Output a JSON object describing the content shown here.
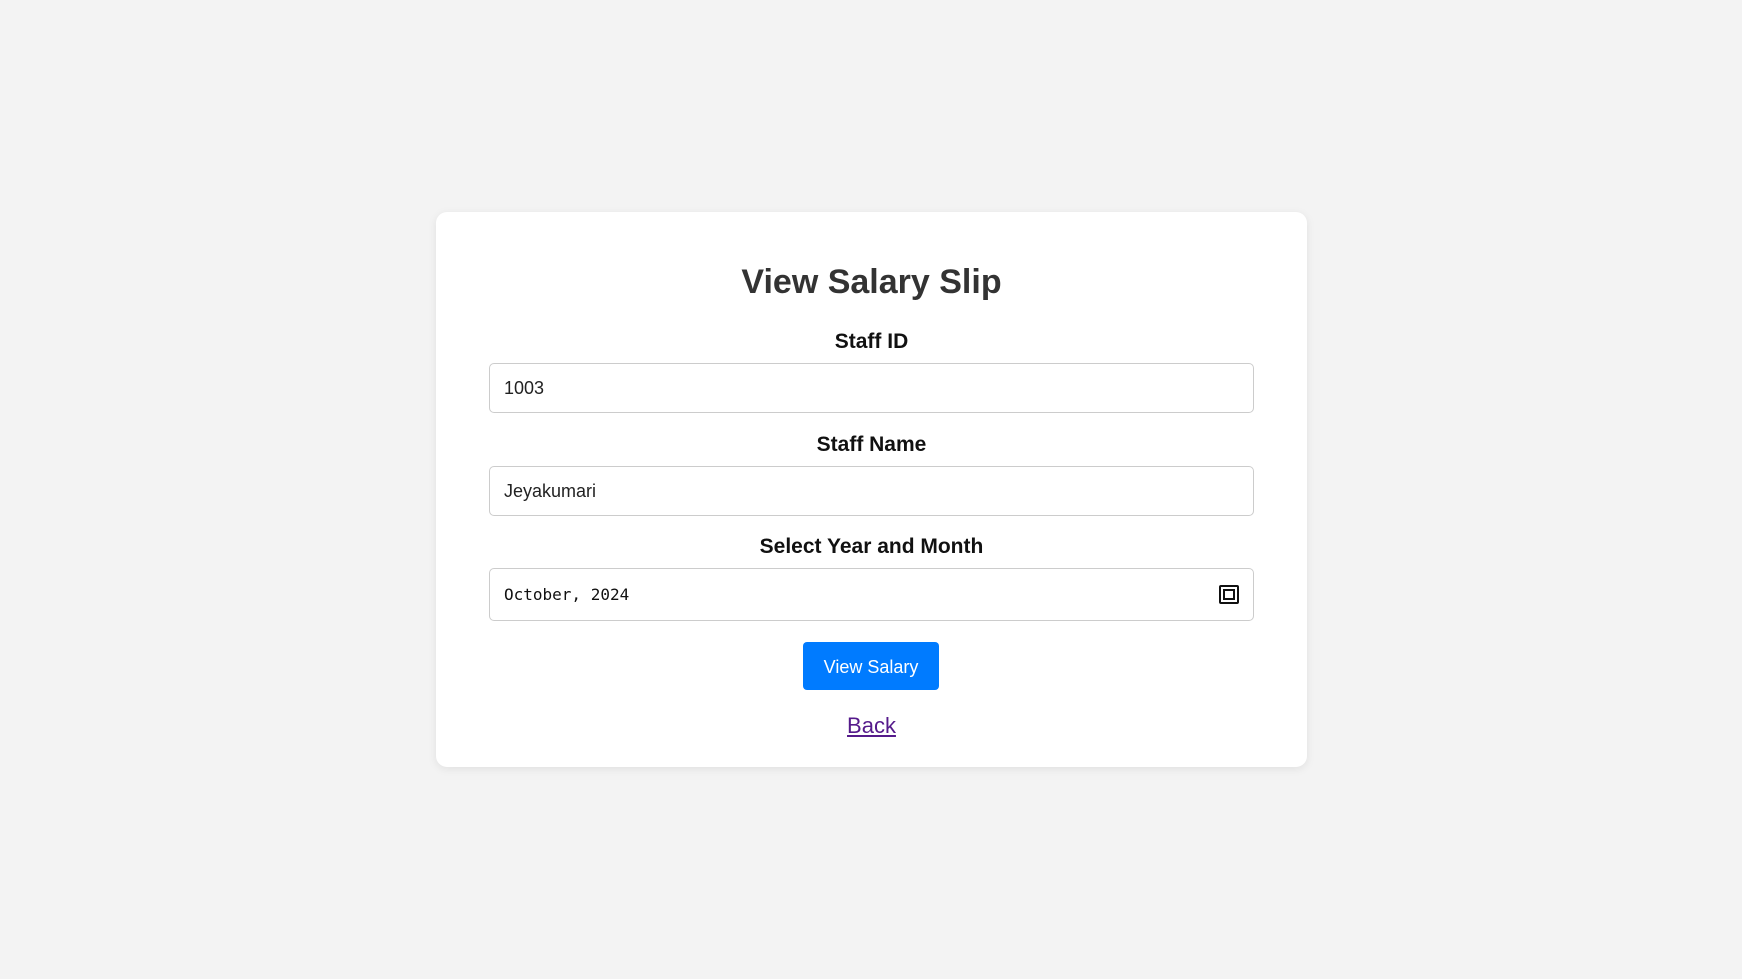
{
  "form": {
    "title": "View Salary Slip",
    "staff_id": {
      "label": "Staff ID",
      "value": "1003"
    },
    "staff_name": {
      "label": "Staff Name",
      "value": "Jeyakumari"
    },
    "year_month": {
      "label": "Select Year and Month",
      "value": "October, 2024",
      "icon": "calendar-icon"
    },
    "submit_label": "View Salary",
    "back_label": "Back"
  },
  "colors": {
    "background": "#f3f3f3",
    "card": "#ffffff",
    "button": "#007bff",
    "link_visited": "#551a8b"
  }
}
